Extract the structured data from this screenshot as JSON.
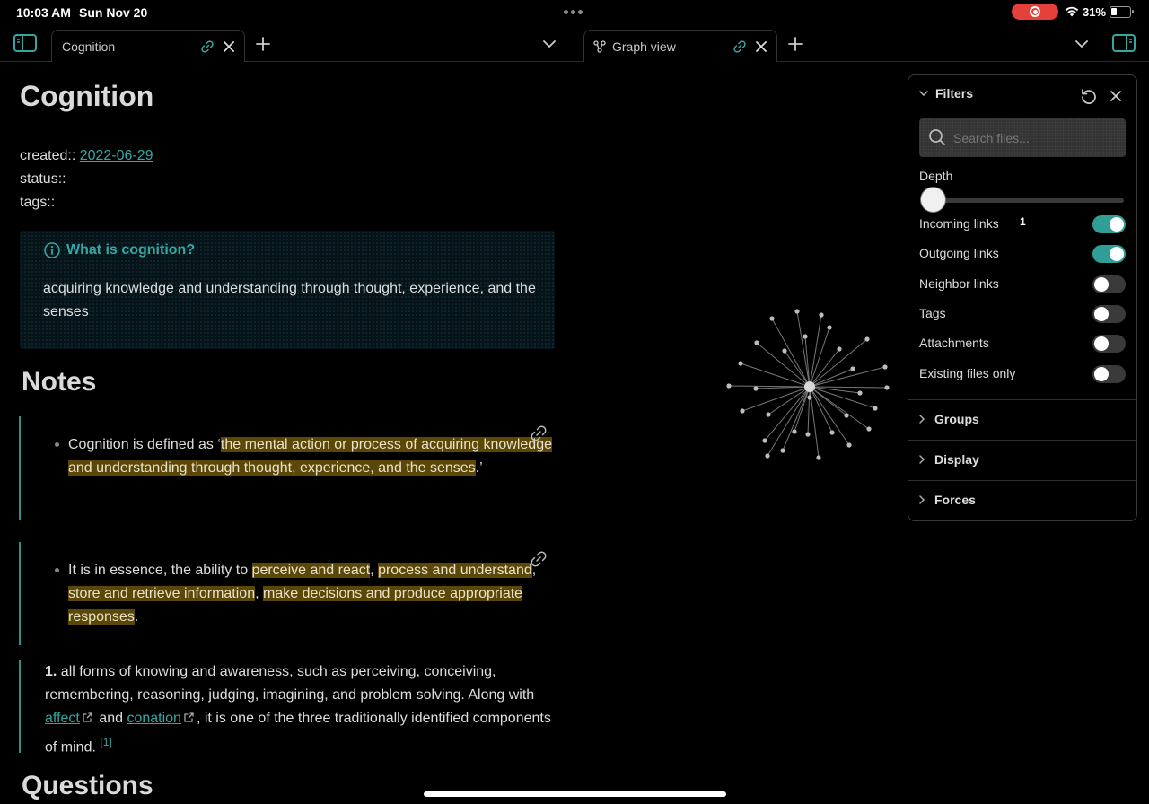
{
  "status": {
    "time": "10:03 AM",
    "date": "Sun Nov 20",
    "battery": "31%"
  },
  "tabs": {
    "left": {
      "title": "Cognition"
    },
    "right": {
      "title": "Graph view"
    }
  },
  "note": {
    "title": "Cognition",
    "props": {
      "created_key": "created::",
      "created_value": "2022-06-29",
      "status_key": "status::",
      "tags_key": "tags::"
    },
    "callout": {
      "title": "What is cognition?",
      "body": "acquiring knowledge and understanding through thought, experience, and the senses"
    },
    "notes_heading": "Notes",
    "bullet1": {
      "pre": "Cognition is defined as ‘",
      "hl": "the mental action or process of acquiring knowledge and understanding through thought, experience, and the senses",
      "post": ".’"
    },
    "bullet2": {
      "pre": "It is in essence, the ability to ",
      "hl1": "perceive and react",
      "sep1": ", ",
      "hl2": "process and understand",
      "sep2": ", ",
      "hl3": "store and retrieve information",
      "sep3": ", ",
      "hl4": "make decisions and produce appropriate responses",
      "post": "."
    },
    "definition": {
      "num": "1.",
      "text1": " all forms of knowing and awareness, such as perceiving, conceiving, remembering, reasoning, judging, imagining, and problem solving. Along with ",
      "link1": "affect",
      "text2": " and ",
      "link2": "conation",
      "text3": ", it is one of the three traditionally identified components of mind. ",
      "ref": "[1]"
    },
    "questions_heading": "Questions"
  },
  "filters": {
    "title": "Filters",
    "search_placeholder": "Search files...",
    "depth_label": "Depth",
    "depth_value": "1",
    "depth_fraction": 0.0,
    "toggles": [
      {
        "label": "Incoming links",
        "on": true
      },
      {
        "label": "Outgoing links",
        "on": true
      },
      {
        "label": "Neighbor links",
        "on": false
      },
      {
        "label": "Tags",
        "on": false
      },
      {
        "label": "Attachments",
        "on": false
      },
      {
        "label": "Existing files only",
        "on": false
      }
    ],
    "sections": [
      "Groups",
      "Display",
      "Forces"
    ]
  },
  "colors": {
    "accent": "#35a7a3",
    "highlight": "#5b4708",
    "toggle_on": "#2f9e97"
  }
}
